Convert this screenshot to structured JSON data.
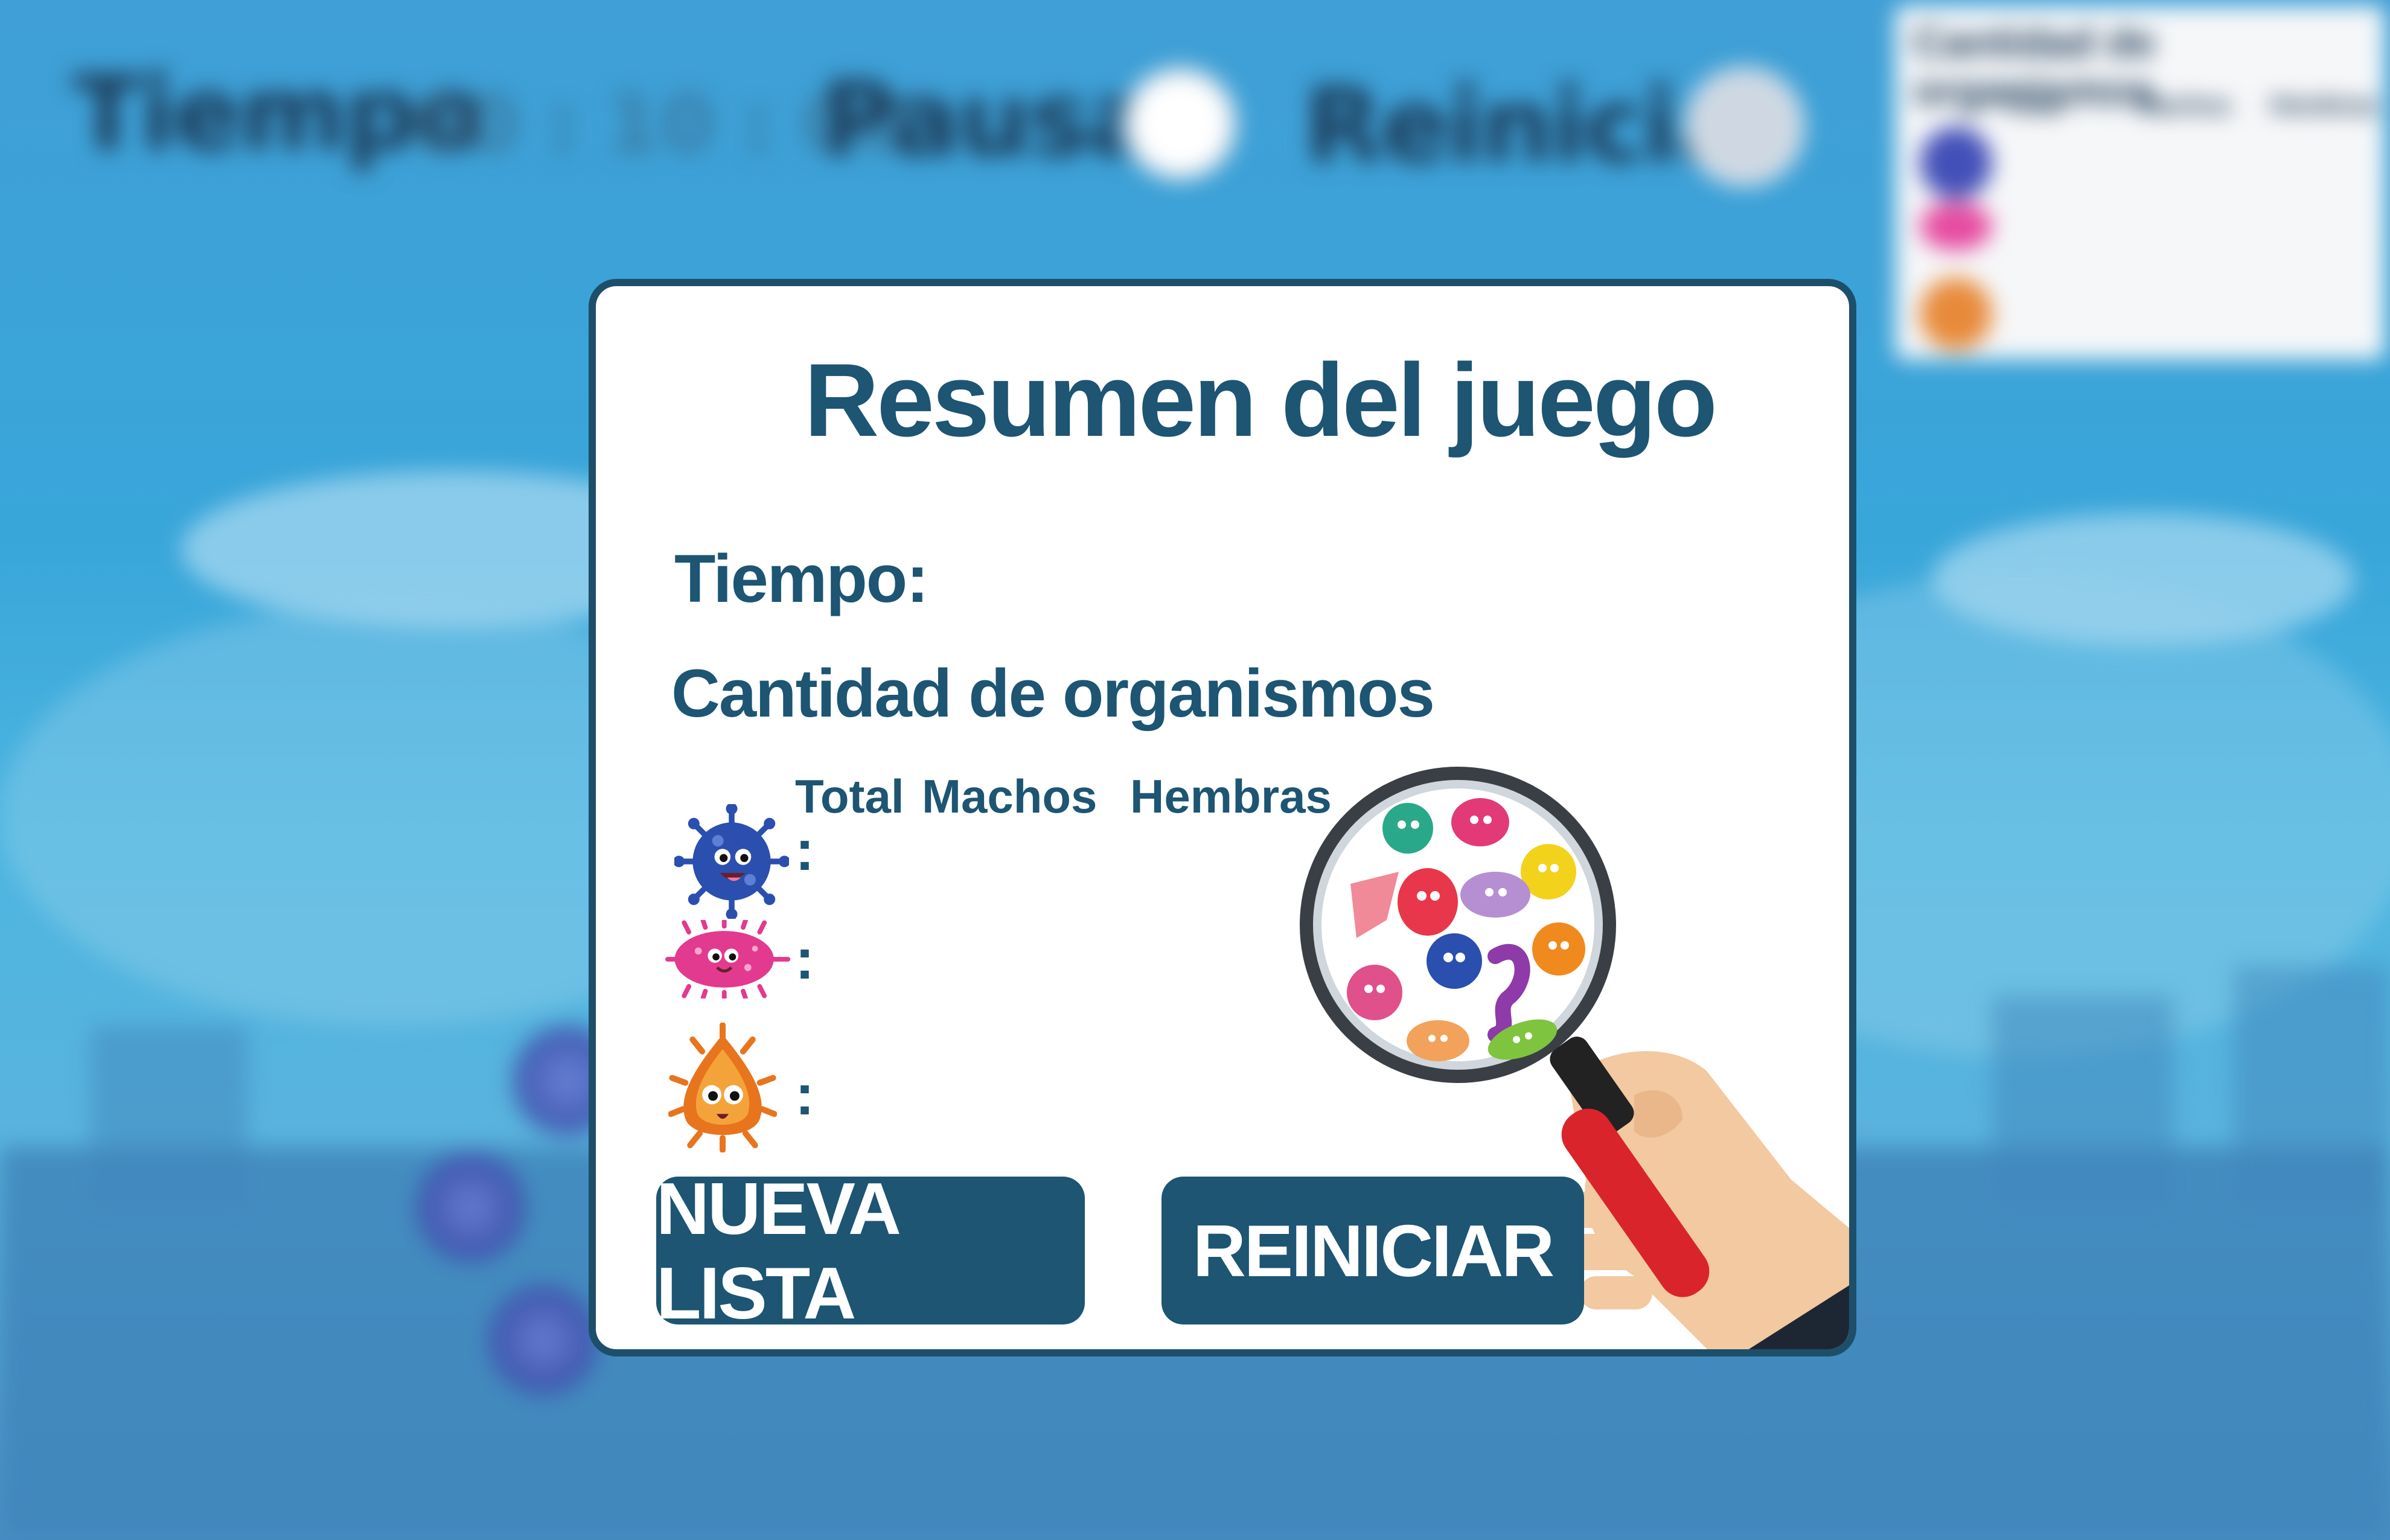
{
  "hud": {
    "time_label": "Tiempo",
    "time_value": "00 : 10 : 00",
    "pause_label": "Pausar",
    "restart_label": "Reiniciar"
  },
  "mini_panel": {
    "title": "Cantidad de organismos",
    "columns": [
      "Total",
      "Machos",
      "Hembras"
    ]
  },
  "summary": {
    "title": "Resumen del juego",
    "time_label": "Tiempo:",
    "count_heading": "Cantidad de organismos",
    "columns": {
      "total": "Total",
      "males": "Machos",
      "females": "Hembras"
    },
    "rows": [
      {
        "organism": "blue-virus",
        "separator": ":"
      },
      {
        "organism": "pink-bacteria",
        "separator": ":"
      },
      {
        "organism": "orange-germ",
        "separator": ":"
      }
    ],
    "new_list_label": "NUEVA LISTA",
    "restart_label": "REINICIAR"
  },
  "colors": {
    "dialog_border": "#1d4f6a",
    "text_primary": "#1d5573",
    "button_bg": "#1d5573",
    "sky": "#39a6da"
  },
  "icons": [
    "blue-virus-icon",
    "pink-bacteria-icon",
    "orange-germ-icon",
    "magnifying-glass-icon",
    "hand-icon",
    "pause-icon",
    "restart-icon"
  ]
}
